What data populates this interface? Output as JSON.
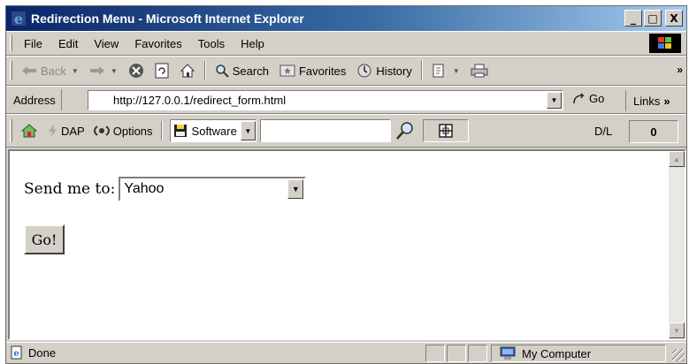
{
  "window": {
    "title": "Redirection Menu - Microsoft Internet Explorer",
    "controls": {
      "minimize": "_",
      "maximize": "□",
      "close": "X"
    }
  },
  "menubar": {
    "items": [
      {
        "label": "File"
      },
      {
        "label": "Edit"
      },
      {
        "label": "View"
      },
      {
        "label": "Favorites"
      },
      {
        "label": "Tools"
      },
      {
        "label": "Help"
      }
    ]
  },
  "toolbar": {
    "back": "Back",
    "search": "Search",
    "favorites": "Favorites",
    "history": "History",
    "chevron": "»"
  },
  "address": {
    "label": "Address",
    "url": "http://127.0.0.1/redirect_form.html",
    "go": "Go",
    "links": "Links",
    "chevron": "»"
  },
  "dapbar": {
    "dap": "DAP",
    "options": "Options",
    "software": "Software",
    "dl_label": "D/L",
    "dl_value": "0"
  },
  "page": {
    "label": "Send me to:",
    "selected": "Yahoo",
    "submit": "Go!"
  },
  "status": {
    "text": "Done",
    "zone": "My Computer"
  },
  "colors": {
    "title_gradient_start": "#0a246a",
    "title_gradient_end": "#a6caf0",
    "chrome": "#d4d0c8"
  },
  "icons": [
    "ie-icon",
    "back-arrow-icon",
    "forward-arrow-icon",
    "stop-icon",
    "refresh-icon",
    "home-icon",
    "search-icon",
    "favorites-icon",
    "history-icon",
    "edit-icon",
    "print-icon",
    "go-arrow-icon",
    "windows-logo-icon",
    "dap-icon",
    "options-icon",
    "save-icon",
    "magnifier-icon",
    "zoom-icon",
    "page-icon",
    "computer-icon"
  ]
}
